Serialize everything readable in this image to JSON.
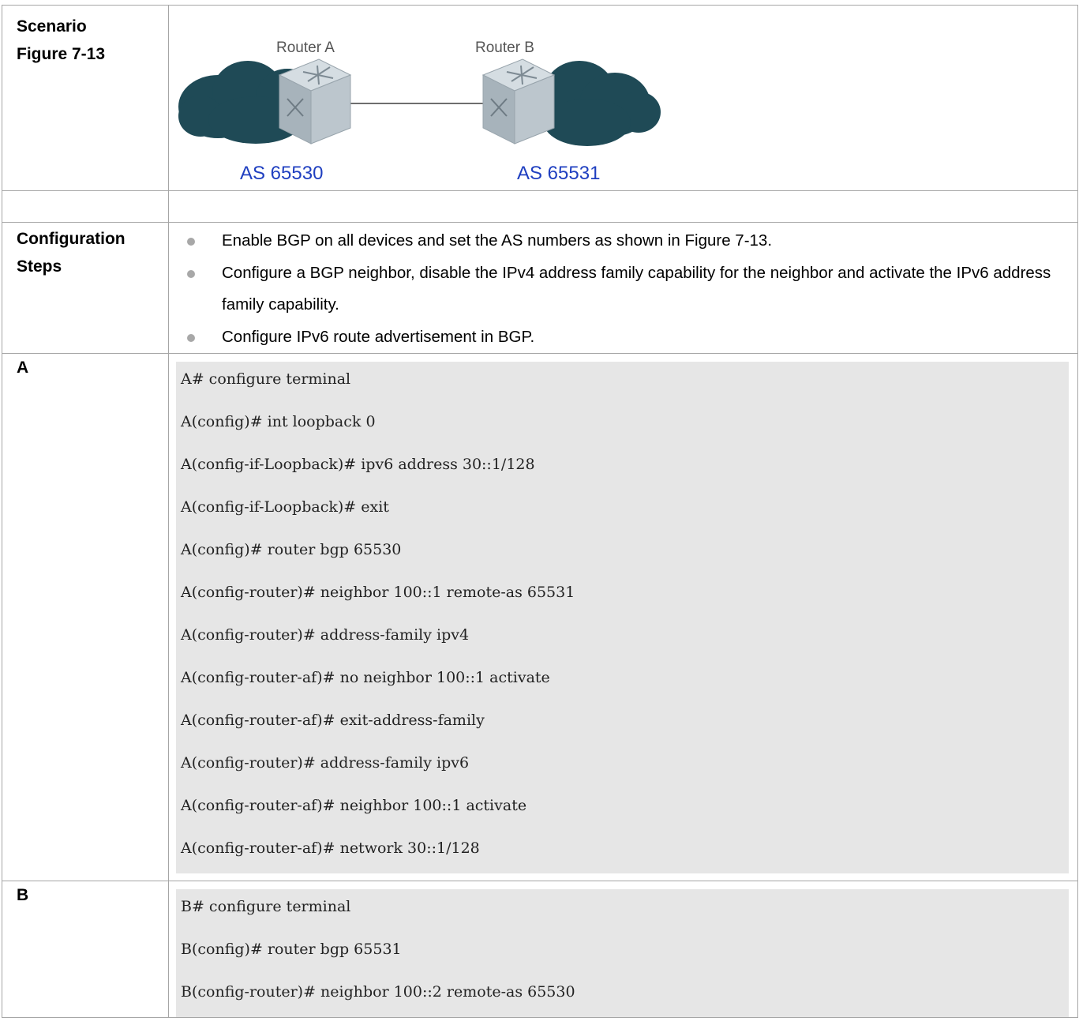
{
  "scenario": {
    "label": "Scenario",
    "figure_label": "Figure 7-13",
    "router_a": "Router A",
    "router_b": "Router B",
    "as_a": "AS 65530",
    "as_b": "AS 65531"
  },
  "steps": {
    "label_1": "Configuration",
    "label_2": "Steps",
    "items": [
      "Enable BGP on all devices and set the AS numbers as shown in Figure 7-13.",
      "Configure a BGP neighbor, disable the IPv4 address family capability for the neighbor and activate the IPv6 address family capability.",
      "Configure IPv6 route advertisement in BGP."
    ]
  },
  "device_a": {
    "label": "A",
    "lines": [
      "A# configure terminal",
      "A(config)# int loopback 0",
      "A(config-if-Loopback)# ipv6 address 30::1/128",
      "A(config-if-Loopback)# exit",
      "A(config)# router bgp 65530",
      "A(config-router)# neighbor 100::1 remote-as 65531",
      "A(config-router)# address-family ipv4",
      "A(config-router-af)# no neighbor 100::1 activate",
      "A(config-router-af)# exit-address-family",
      "A(config-router)# address-family ipv6",
      "A(config-router-af)# neighbor 100::1 activate",
      "A(config-router-af)# network 30::1/128"
    ]
  },
  "device_b": {
    "label": "B",
    "lines": [
      "B# configure terminal",
      "B(config)# router bgp 65531",
      "B(config-router)# neighbor 100::2 remote-as 65530"
    ]
  },
  "colors": {
    "cloud": "#1f4a56",
    "router_top": "#c9d2d8",
    "router_front": "#a9b4bc",
    "as_text": "#1f3fc0",
    "code_bg": "#e6e6e6"
  }
}
